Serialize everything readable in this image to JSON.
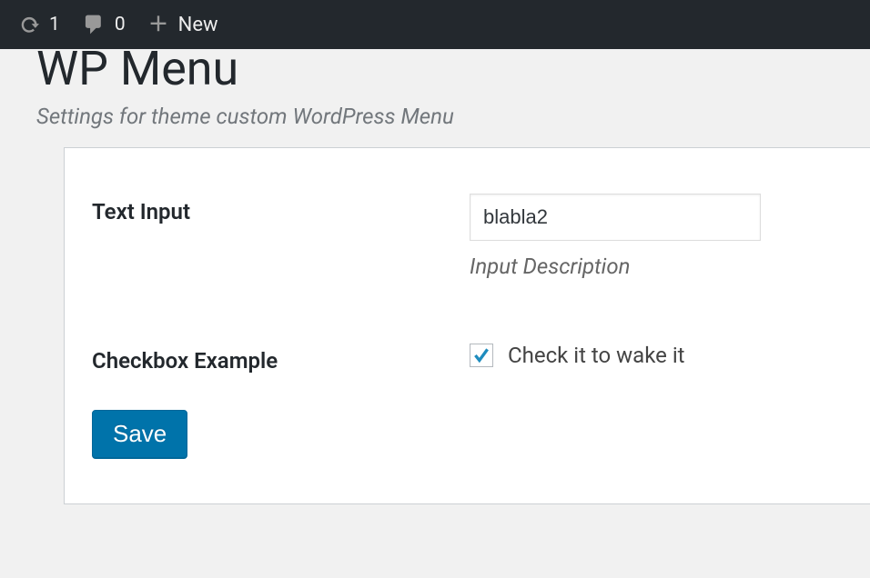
{
  "admin_bar": {
    "updates_count": "1",
    "comments_count": "0",
    "new_label": "New"
  },
  "page": {
    "title": "WP Menu",
    "subtitle": "Settings for theme custom WordPress Menu"
  },
  "form": {
    "text_input": {
      "label": "Text Input",
      "value": "blabla2",
      "description": "Input Description"
    },
    "checkbox": {
      "label": "Checkbox Example",
      "option_label": "Check it to wake it",
      "checked": true
    },
    "save_label": "Save"
  }
}
